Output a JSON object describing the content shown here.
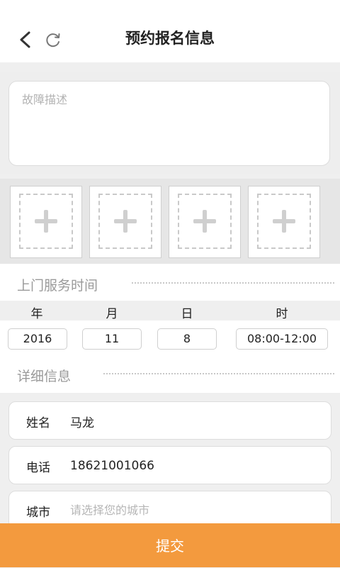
{
  "header": {
    "title": "预约报名信息",
    "back_icon": "chevron-left-icon",
    "refresh_icon": "refresh-icon"
  },
  "description": {
    "placeholder": "故障描述",
    "value": ""
  },
  "photos": {
    "slot_count": 4,
    "icon": "plus-icon"
  },
  "service_time": {
    "title": "上门服务时间",
    "labels": {
      "year": "年",
      "month": "月",
      "day": "日",
      "time": "时"
    },
    "values": {
      "year": "2016",
      "month": "11",
      "day": "8",
      "time": "08:00-12:00"
    }
  },
  "details": {
    "title": "详细信息",
    "name": {
      "label": "姓名",
      "value": "马龙"
    },
    "phone": {
      "label": "电话",
      "value": "18621001066"
    },
    "city": {
      "label": "城市",
      "value": "",
      "placeholder": "请选择您的城市"
    }
  },
  "submit": {
    "label": "提交"
  },
  "colors": {
    "accent": "#f39a3e",
    "background": "#efefef",
    "placeholder": "#b3b3b3"
  }
}
